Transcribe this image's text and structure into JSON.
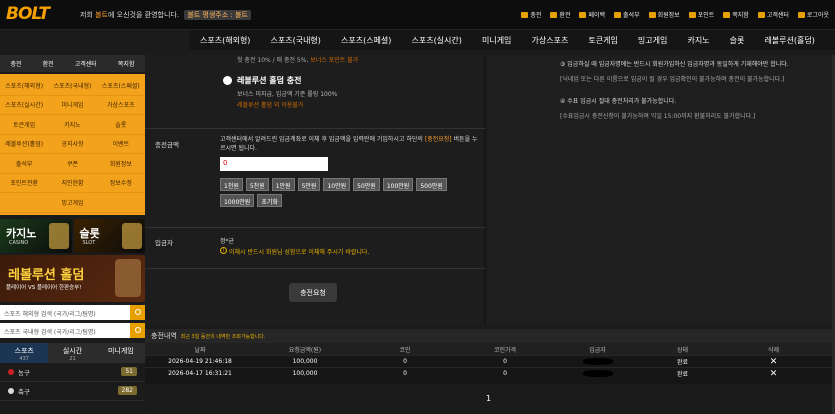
{
  "header": {
    "logo_main": "BOLT",
    "welcome_prefix": "저희 ",
    "welcome_brand": "볼트",
    "welcome_suffix": "에 오신것을 환영합니다.",
    "domain_pill": "볼트 평생주소 : 볼트",
    "links": [
      "충전",
      "환전",
      "페이백",
      "출석부",
      "회원정보",
      "포인트",
      "쪽지함",
      "고객센터",
      "로그아웃"
    ]
  },
  "nav": [
    "스포츠(해외형)",
    "스포츠(국내형)",
    "스포츠(스페셜)",
    "스포츠(실시간)",
    "미니게임",
    "가상스포츠",
    "토큰게임",
    "밍고게임",
    "카지노",
    "슬롯",
    "레볼루션(홀덤)"
  ],
  "sidebar": {
    "account": [
      "충전",
      "환전",
      "고객센터",
      "쪽지함"
    ],
    "menu": [
      "스포츠(해외형)",
      "스포츠(국내형)",
      "스포츠(스페셜)",
      "스포츠(실시간)",
      "미니게임",
      "가상스포츠",
      "토큰게임",
      "카지노",
      "슬롯",
      "레볼루션(홀덤)",
      "공지사항",
      "이벤트",
      "출석부",
      "쿠폰",
      "회원정보",
      "포인트전환",
      "지인현황",
      "정보수정",
      "",
      "밍고게임",
      ""
    ],
    "casino_title": "카지노",
    "casino_sub": "CASINO",
    "slot_title": "슬롯",
    "slot_sub": "SLOT",
    "revolution_title": "레볼루션 홀덤",
    "revolution_sub": "플레이어 VS 플레이어 한판승부!",
    "search1": "스포츠 해외형 검색 (국가/리그/팀명)",
    "search2": "스포츠 국내형 검색 (국가/리그/팀명)",
    "tabs": [
      {
        "label": "스포츠",
        "count": "437"
      },
      {
        "label": "실시간",
        "count": "21"
      },
      {
        "label": "미니게임",
        "count": ""
      }
    ],
    "leagues": [
      {
        "name": "농구",
        "count": "51"
      },
      {
        "name": "축구",
        "count": "282"
      }
    ]
  },
  "deposit": {
    "fade_text_a": "첫 충전 10% / 매 충전 5%, ",
    "fade_text_b": "보너스 포인트 불가",
    "option_label": "레볼루션 홀덤 충전",
    "option_sub": "보너스 미지급, 입금액 기준 롤링 100%",
    "option_note": "레볼루션 홀덤 외 이용불가",
    "amount_label": "충전금액",
    "amount_desc_a": "고객센터에서 알려드린 입금계좌로 이체 후 입금액을 입력란에 기입하시고 하단의 ",
    "amount_desc_b": "[충전요청]",
    "amount_desc_c": " 버튼을 누르시면 됩니다.",
    "amount_value": "0",
    "chips": [
      "1천원",
      "5천원",
      "1만원",
      "5만원",
      "10만원",
      "50만원",
      "100만원",
      "500만원",
      "1000만원",
      "초기화"
    ],
    "depositor_label": "입금자",
    "depositor_name": "정*균",
    "warning": "이체시 반드시 회원님 성함으로 이체해 주시기 바랍니다.",
    "apply": "충전요청"
  },
  "notices": [
    {
      "title": "③ 입금하실 때 입금자명에는 반드시 회원가입하신 입금자명과 동일하게 기재해야만 합니다.",
      "body": "[닉네임 또는 다른 이름으로 입금이 될 경우 입금확인이 불가능하며 충전이 불가능합니다.]"
    },
    {
      "title": "④ 수표 입금시 절대 충전처리가 불가능합니다.",
      "body": "[수표입금시 충전신청이 불가능하며 익일 15:00까지 환불처리도 불가합니다.]"
    }
  ],
  "history": {
    "title": "충전내역",
    "subtitle": "최근 3일 동안의 내역만 조회가능합니다.",
    "columns": [
      "날짜",
      "요청금액(원)",
      "코인",
      "코인가격",
      "입금자",
      "상태",
      "삭제"
    ],
    "rows": [
      {
        "date": "2026-04-19 21:46:18",
        "amount": "100,000",
        "coin": "0",
        "price": "0",
        "status": "완료"
      },
      {
        "date": "2026-04-17 16:31:21",
        "amount": "100,000",
        "coin": "0",
        "price": "0",
        "status": "완료"
      }
    ],
    "page": "1"
  }
}
